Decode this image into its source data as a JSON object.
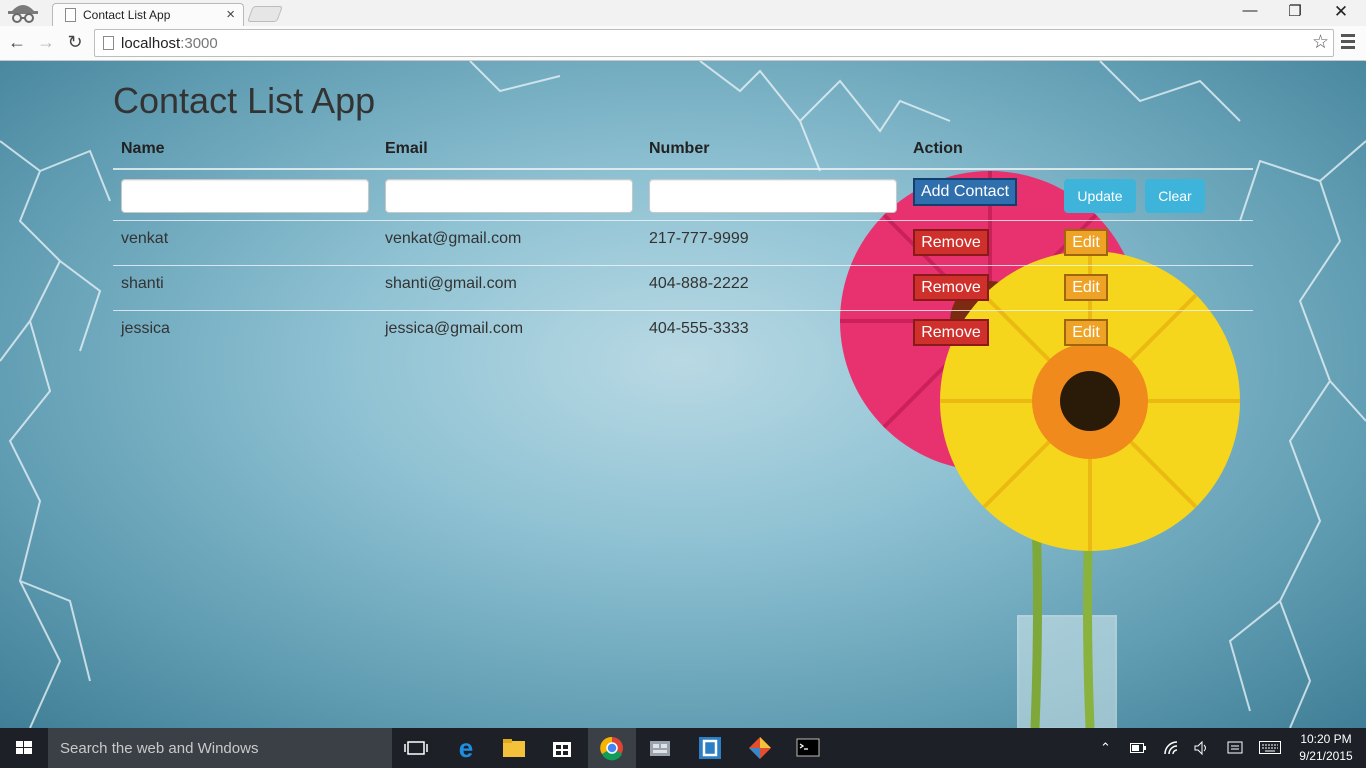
{
  "browser": {
    "tab_title": "Contact List App",
    "tab_close": "×",
    "url_host": "localhost",
    "url_port": ":3000",
    "window_minimize": "—",
    "window_maximize": "❐",
    "window_close": "✕"
  },
  "app": {
    "title": "Contact List App",
    "columns": {
      "name": "Name",
      "email": "Email",
      "number": "Number",
      "action": "Action"
    },
    "form": {
      "name_value": "",
      "email_value": "",
      "number_value": "",
      "add_label": "Add Contact",
      "update_label": "Update",
      "clear_label": "Clear"
    },
    "contacts": [
      {
        "name": "venkat",
        "email": "venkat@gmail.com",
        "number": "217-777-9999",
        "remove_label": "Remove",
        "edit_label": "Edit"
      },
      {
        "name": "shanti",
        "email": "shanti@gmail.com",
        "number": "404-888-2222",
        "remove_label": "Remove",
        "edit_label": "Edit"
      },
      {
        "name": "jessica",
        "email": "jessica@gmail.com",
        "number": "404-555-3333",
        "remove_label": "Remove",
        "edit_label": "Edit"
      }
    ],
    "colors": {
      "add_button": "#2f6fad",
      "update_button": "#3fb4da",
      "remove_button": "#d0302c",
      "edit_button": "#eea326"
    }
  },
  "taskbar": {
    "search_placeholder": "Search the web and Windows",
    "time": "10:20 PM",
    "date": "9/21/2015",
    "icons": [
      "task-view-icon",
      "edge-icon",
      "file-explorer-icon",
      "store-icon",
      "chrome-icon",
      "app-icon",
      "brackets-icon",
      "git-icon",
      "terminal-icon"
    ]
  }
}
